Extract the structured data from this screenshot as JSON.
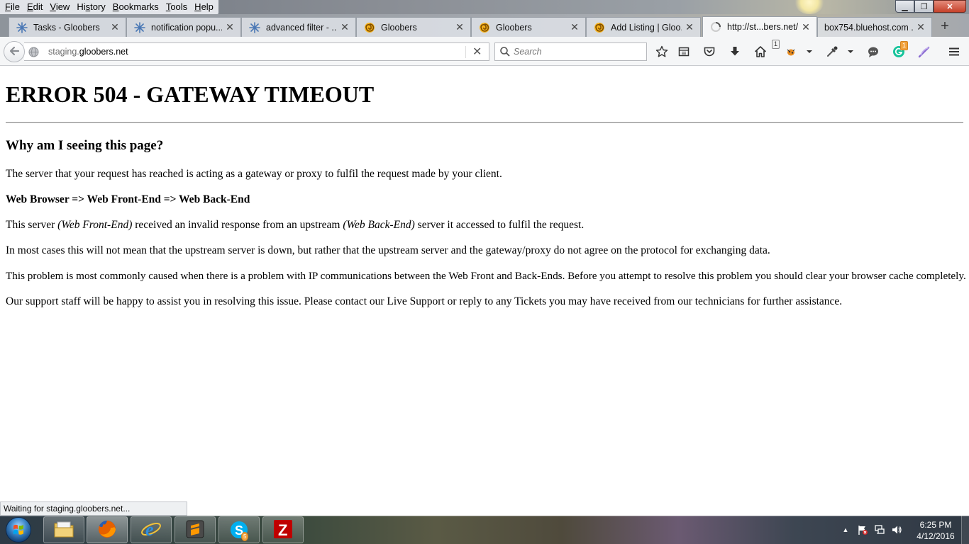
{
  "menubar": {
    "items": [
      {
        "ul": "F",
        "rest": "ile"
      },
      {
        "ul": "E",
        "rest": "dit"
      },
      {
        "ul": "V",
        "rest": "iew"
      },
      {
        "ul": "",
        "pre": "Hi",
        "ul2": "s",
        "rest": "tory"
      },
      {
        "ul": "B",
        "rest": "ookmarks"
      },
      {
        "ul": "T",
        "rest": "ools"
      },
      {
        "ul": "H",
        "rest": "elp"
      }
    ],
    "min_glyph": "▁",
    "max_glyph": "❐",
    "close_glyph": "✕"
  },
  "tabs": [
    {
      "label": "Tasks - Gloobers",
      "icon": "snowflake-icon",
      "close": "✕"
    },
    {
      "label": "notification popu...",
      "icon": "snowflake-icon",
      "close": "✕"
    },
    {
      "label": "advanced filter - ...",
      "icon": "snowflake-icon",
      "close": "✕"
    },
    {
      "label": "Gloobers",
      "icon": "gloobers-swirl-icon",
      "close": "✕"
    },
    {
      "label": "Gloobers",
      "icon": "gloobers-swirl-icon",
      "close": "✕"
    },
    {
      "label": "Add Listing | Gloo...",
      "icon": "gloobers-swirl-icon",
      "close": "✕"
    },
    {
      "label": "http://st...bers.net/",
      "icon": "loading-spinner-icon",
      "close": "✕"
    },
    {
      "label": "box754.bluehost.com ...",
      "icon": "",
      "close": "✕"
    }
  ],
  "new_tab_glyph": "+",
  "nav": {
    "url_prefix": "staging.",
    "url_domain": "gloobers.net",
    "stop_glyph": "✕",
    "search_placeholder": "Search",
    "home_badge": "1",
    "grammarly_badge": "1"
  },
  "page": {
    "title": "ERROR 504 - GATEWAY TIMEOUT",
    "subheading": "Why am I seeing this page?",
    "p1": "The server that your request has reached is acting as a gateway or proxy to fulfil the request made by your client.",
    "p2": "Web Browser => Web Front-End => Web Back-End",
    "p3_a": "This server ",
    "p3_b": "(Web Front-End)",
    "p3_c": " received an invalid response from an upstream ",
    "p3_d": "(Web Back-End)",
    "p3_e": " server it accessed to fulfil the request.",
    "p4": "In most cases this will not mean that the upstream server is down, but rather that the upstream server and the gateway/proxy do not agree on the protocol for exchanging data.",
    "p5": "This problem is most commonly caused when there is a problem with IP communications between the Web Front and Back-Ends. Before you attempt to resolve this problem you should clear your browser cache completely.",
    "p6": "Our support staff will be happy to assist you in resolving this issue. Please contact our Live Support or reply to any Tickets you may have received from our technicians for further assistance."
  },
  "status_text": "Waiting for staging.gloobers.net...",
  "taskbar": {
    "skype_badge": "5",
    "filezilla_glyph": "Z",
    "ie_glyph": "e",
    "tray_up_glyph": "▲",
    "time": "6:25 PM",
    "date": "4/12/2016"
  },
  "colors": {
    "firefox_orange": "#e66000",
    "skype_blue": "#00aff0",
    "filezilla_red": "#bf0000",
    "grammarly_green": "#15c39a"
  }
}
